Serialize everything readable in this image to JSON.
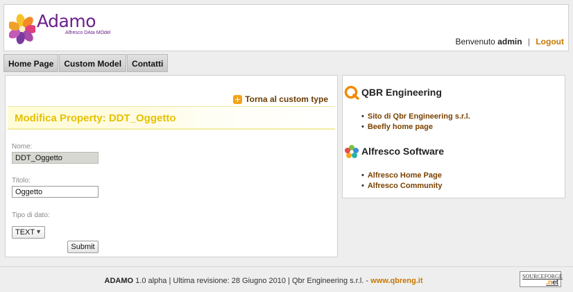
{
  "header": {
    "logo_title": "Adamo",
    "logo_subtitle": "Alfresco DAta MOdel",
    "welcome_text": "Benvenuto",
    "username": "admin",
    "separator": "|",
    "logout_label": "Logout"
  },
  "nav": {
    "items": [
      {
        "label": "Home Page"
      },
      {
        "label": "Custom Model"
      },
      {
        "label": "Contatti"
      }
    ]
  },
  "main": {
    "back_link_label": "Torna al custom type",
    "title": "Modifica Property: DDT_Oggetto",
    "name_label": "Nome:",
    "name_value": "DDT_Oggetto",
    "title_label": "Titolo:",
    "title_value": "Oggetto",
    "type_label": "Tipo di dato:",
    "type_value": "TEXT",
    "submit_label": "Submit"
  },
  "sidebar": {
    "sections": [
      {
        "heading": "QBR Engineering",
        "links": [
          {
            "label": "Sito di Qbr Engineering s.r.l."
          },
          {
            "label": "Beefly home page"
          }
        ]
      },
      {
        "heading": "Alfresco Software",
        "links": [
          {
            "label": "Alfresco Home Page"
          },
          {
            "label": "Alfresco Community"
          }
        ]
      }
    ]
  },
  "footer": {
    "brand": "ADAMO",
    "text": "1.0 alpha | Ultima revisione: 28 Giugno 2010 | Qbr Engineering s.r.l. -",
    "website": "www.qbreng.it",
    "sf_top": "SOURCEFORGE",
    "sf_bottom": ".net"
  },
  "colors": {
    "accent_title": "#e7c100",
    "link": "#7a4200",
    "logout": "#c77800",
    "logo": "#6a1f8a"
  }
}
